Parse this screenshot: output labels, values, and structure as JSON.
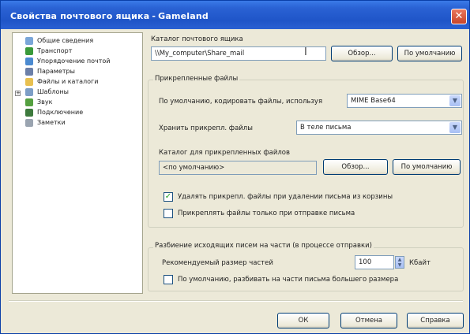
{
  "window": {
    "title": "Свойства почтового ящика",
    "subtitle": "Gameland",
    "title_separator": "-"
  },
  "tree": {
    "items": [
      {
        "label": "Общие сведения",
        "icon": "general-icon",
        "color": "#7aa6d8"
      },
      {
        "label": "Транспорт",
        "icon": "transport-icon",
        "color": "#3a9a3a"
      },
      {
        "label": "Упорядочение почтой",
        "icon": "mail-order-icon",
        "color": "#4b8ad0"
      },
      {
        "label": "Параметры",
        "icon": "params-icon",
        "color": "#6b7fa8"
      },
      {
        "label": "Файлы и каталоги",
        "icon": "folder-icon",
        "color": "#e8c050"
      },
      {
        "label": "Шаблоны",
        "icon": "templates-icon",
        "color": "#7d9ec6"
      },
      {
        "label": "Звук",
        "icon": "sound-icon",
        "color": "#55a040"
      },
      {
        "label": "Подключение",
        "icon": "connection-icon",
        "color": "#3d7a3d"
      },
      {
        "label": "Заметки",
        "icon": "notes-icon",
        "color": "#9aa4b0"
      }
    ]
  },
  "mailbox_dir": {
    "label": "Каталог почтового ящика",
    "value": "\\\\My_computer\\Share_mail",
    "browse": "Обзор...",
    "default": "По умолчанию"
  },
  "attachments": {
    "title": "Прикрепленные файлы",
    "encode_label": "По умолчанию, кодировать файлы, используя",
    "encode_value": "MIME Base64",
    "store_label": "Хранить прикрепл. файлы",
    "store_value": "В теле письма",
    "dir_label": "Каталог для прикрепленных файлов",
    "dir_value": "<по умолчанию>",
    "browse": "Обзор...",
    "default": "По умолчанию",
    "delete_check_label": "Удалять прикрепл. файлы при удалении письма из корзины",
    "delete_checked": true,
    "attach_on_send_label": "Прикреплять файлы только при отправке письма",
    "attach_on_send_checked": false
  },
  "splitting": {
    "title": "Разбиение исходящих писем на части (в процессе отправки)",
    "size_label": "Рекомендуемый размер частей",
    "size_value": "100",
    "size_unit": "Кбайт",
    "split_check_label": "По умолчанию, разбивать на части письма большего размера",
    "split_checked": false
  },
  "buttons": {
    "ok": "ОК",
    "cancel": "Отмена",
    "help": "Справка"
  }
}
